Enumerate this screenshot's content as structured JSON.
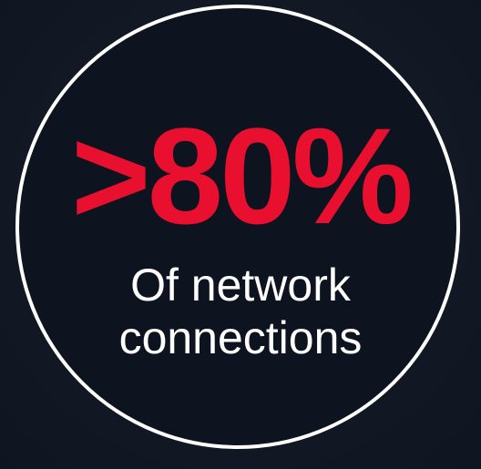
{
  "stat": {
    "value": ">80%",
    "caption_line1": "Of network",
    "caption_line2": "connections"
  },
  "colors": {
    "background": "#141b27",
    "circle_fill": "#0e1320",
    "circle_border": "#ffffff",
    "accent": "#e8102e",
    "caption": "#ffffff"
  }
}
